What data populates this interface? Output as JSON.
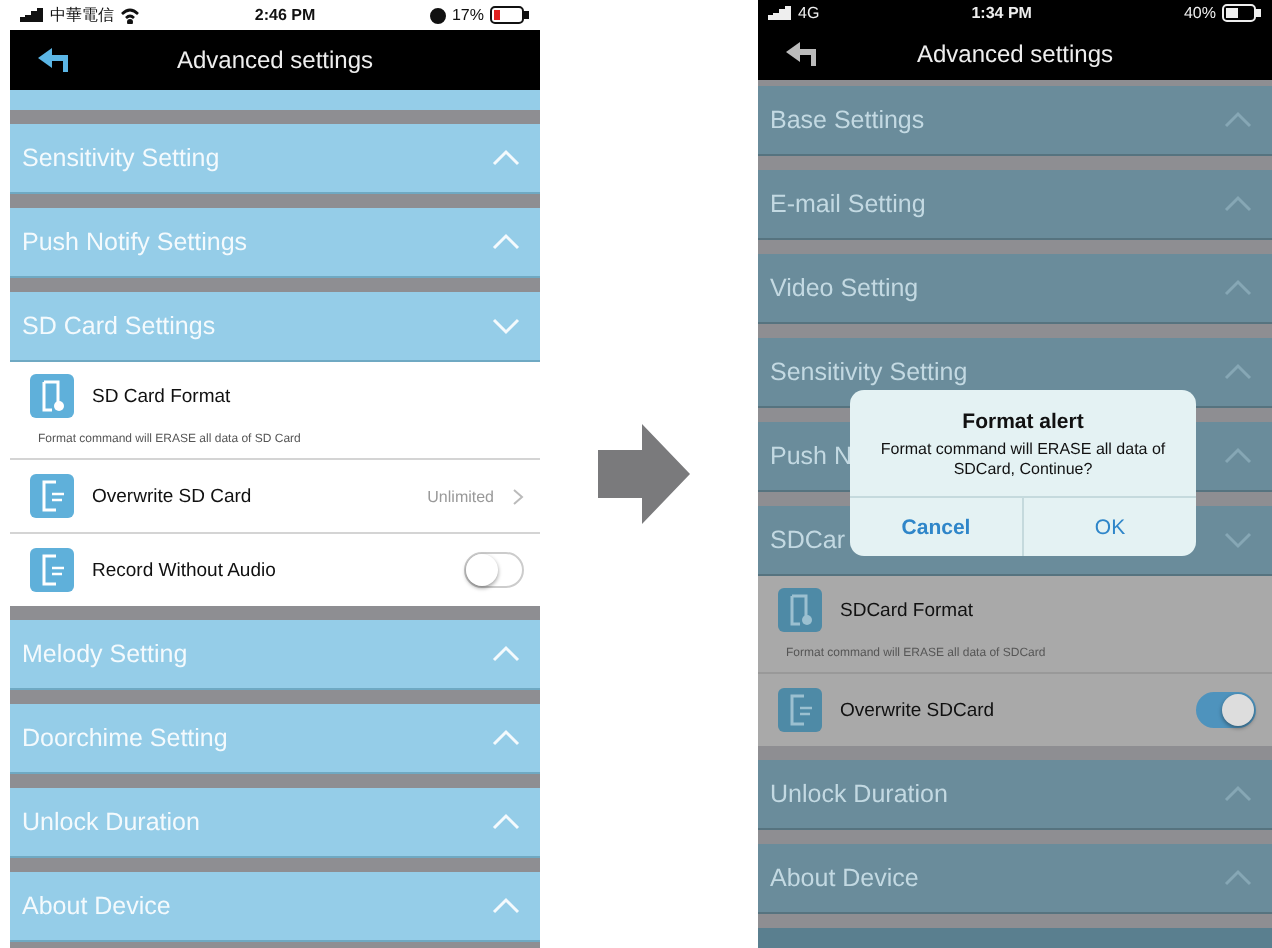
{
  "phones": [
    {
      "dimmed": false,
      "status_bar": {
        "carrier": "中華電信",
        "time": "2:46 PM",
        "battery": "17%"
      },
      "nav": {
        "title": "Advanced settings"
      },
      "top_strip": true,
      "bottom_strip": false,
      "sections": [
        {
          "title": "Sensitivity Setting",
          "expanded": false
        },
        {
          "title": "Push Notify Settings",
          "expanded": false
        },
        {
          "title": "SD Card Settings",
          "expanded": true,
          "items": [
            {
              "kind": "action",
              "label": "SD Card Format",
              "note": "Format command will ERASE all data of SD Card"
            },
            {
              "kind": "link",
              "label": "Overwrite SD Card",
              "value": "Unlimited"
            },
            {
              "kind": "toggle",
              "label": "Record Without Audio",
              "on": false
            }
          ]
        },
        {
          "title": "Melody Setting",
          "expanded": false
        },
        {
          "title": "Doorchime Setting",
          "expanded": false
        },
        {
          "title": "Unlock Duration",
          "expanded": false
        },
        {
          "title": "About Device",
          "expanded": false
        }
      ]
    },
    {
      "dimmed": true,
      "status_bar": {
        "carrier": "4G",
        "time": "1:34 PM",
        "battery": "40%"
      },
      "nav": {
        "title": "Advanced settings"
      },
      "top_strip": false,
      "bottom_strip": true,
      "sections": [
        {
          "title": "Base Settings",
          "expanded": false
        },
        {
          "title": "E-mail Setting",
          "expanded": false
        },
        {
          "title": "Video Setting",
          "expanded": false
        },
        {
          "title": "Sensitivity Setting",
          "expanded": false
        },
        {
          "title": "Push N",
          "expanded": false
        },
        {
          "title": "SDCar",
          "expanded": true,
          "items": [
            {
              "kind": "action",
              "label": "SDCard Format",
              "note": "Format command will ERASE all data of SDCard"
            },
            {
              "kind": "toggle",
              "label": "Overwrite SDCard",
              "on": true
            }
          ]
        },
        {
          "title": "Unlock Duration",
          "expanded": false
        },
        {
          "title": "About Device",
          "expanded": false
        }
      ],
      "dialog": {
        "title": "Format alert",
        "message": "Format command will ERASE all data of SDCard, Continue?",
        "buttons": [
          "Cancel",
          "OK"
        ]
      }
    }
  ]
}
